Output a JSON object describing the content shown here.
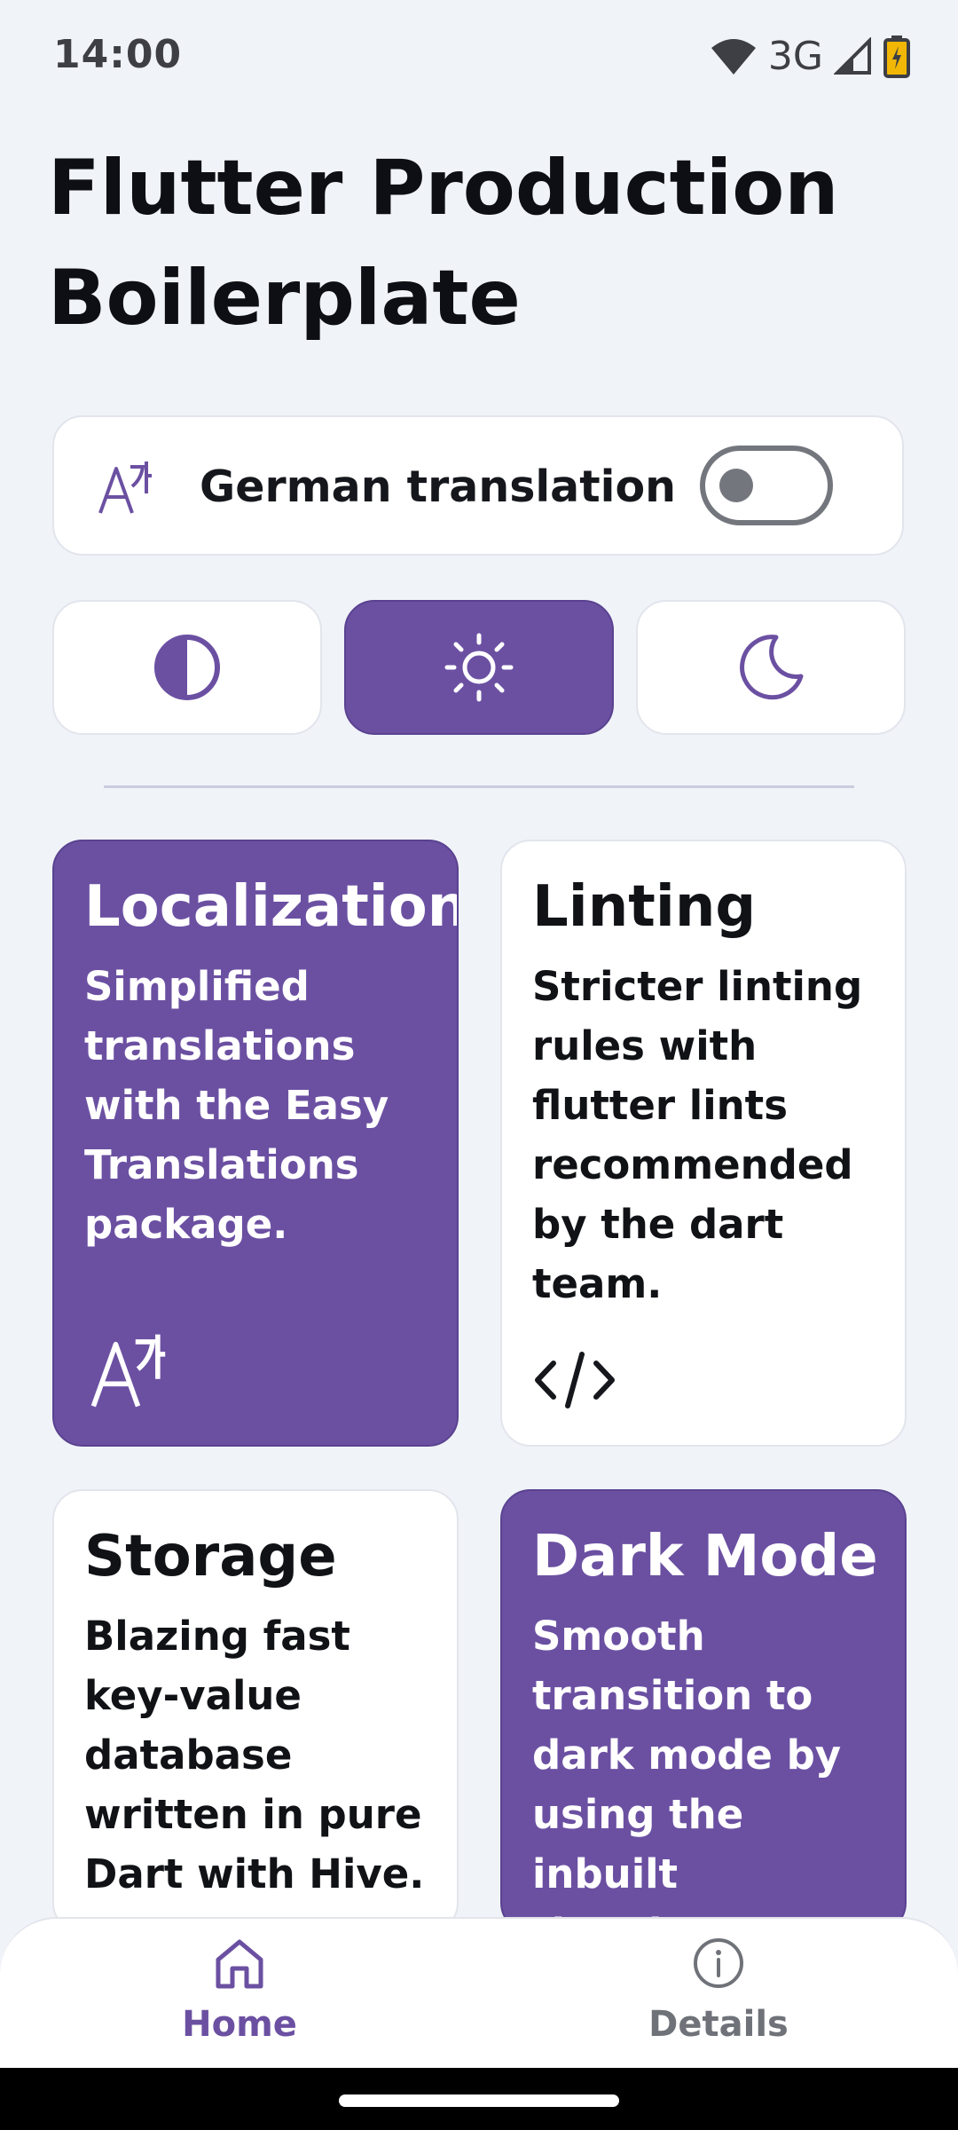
{
  "status_bar": {
    "time": "14:00",
    "network": "3G"
  },
  "app": {
    "title": "Flutter Production Boilerplate"
  },
  "language": {
    "label": "German translation",
    "toggle_on": false
  },
  "theme_modes": {
    "options": [
      "system",
      "light",
      "dark"
    ],
    "selected": "light"
  },
  "colors": {
    "accent": "#6b50a2",
    "background": "#f0f3f8",
    "card": "#ffffff"
  },
  "cards": [
    {
      "title": "Localization",
      "text": "Simplified translations with the Easy Translations package.",
      "icon": "translate-icon",
      "style": "purple"
    },
    {
      "title": "Linting",
      "text": "Stricter linting rules with flutter lints recommended by the dart team.",
      "icon": "code-icon",
      "style": "white"
    },
    {
      "title": "Storage",
      "text": "Blazing fast key-value database written in pure Dart with Hive.",
      "icon": "",
      "style": "white"
    },
    {
      "title": "Dark Mode",
      "text": "Smooth transition to dark mode by using the inbuilt theming engine",
      "icon": "",
      "style": "purple"
    }
  ],
  "nav": {
    "home": "Home",
    "details": "Details",
    "selected": "home"
  }
}
